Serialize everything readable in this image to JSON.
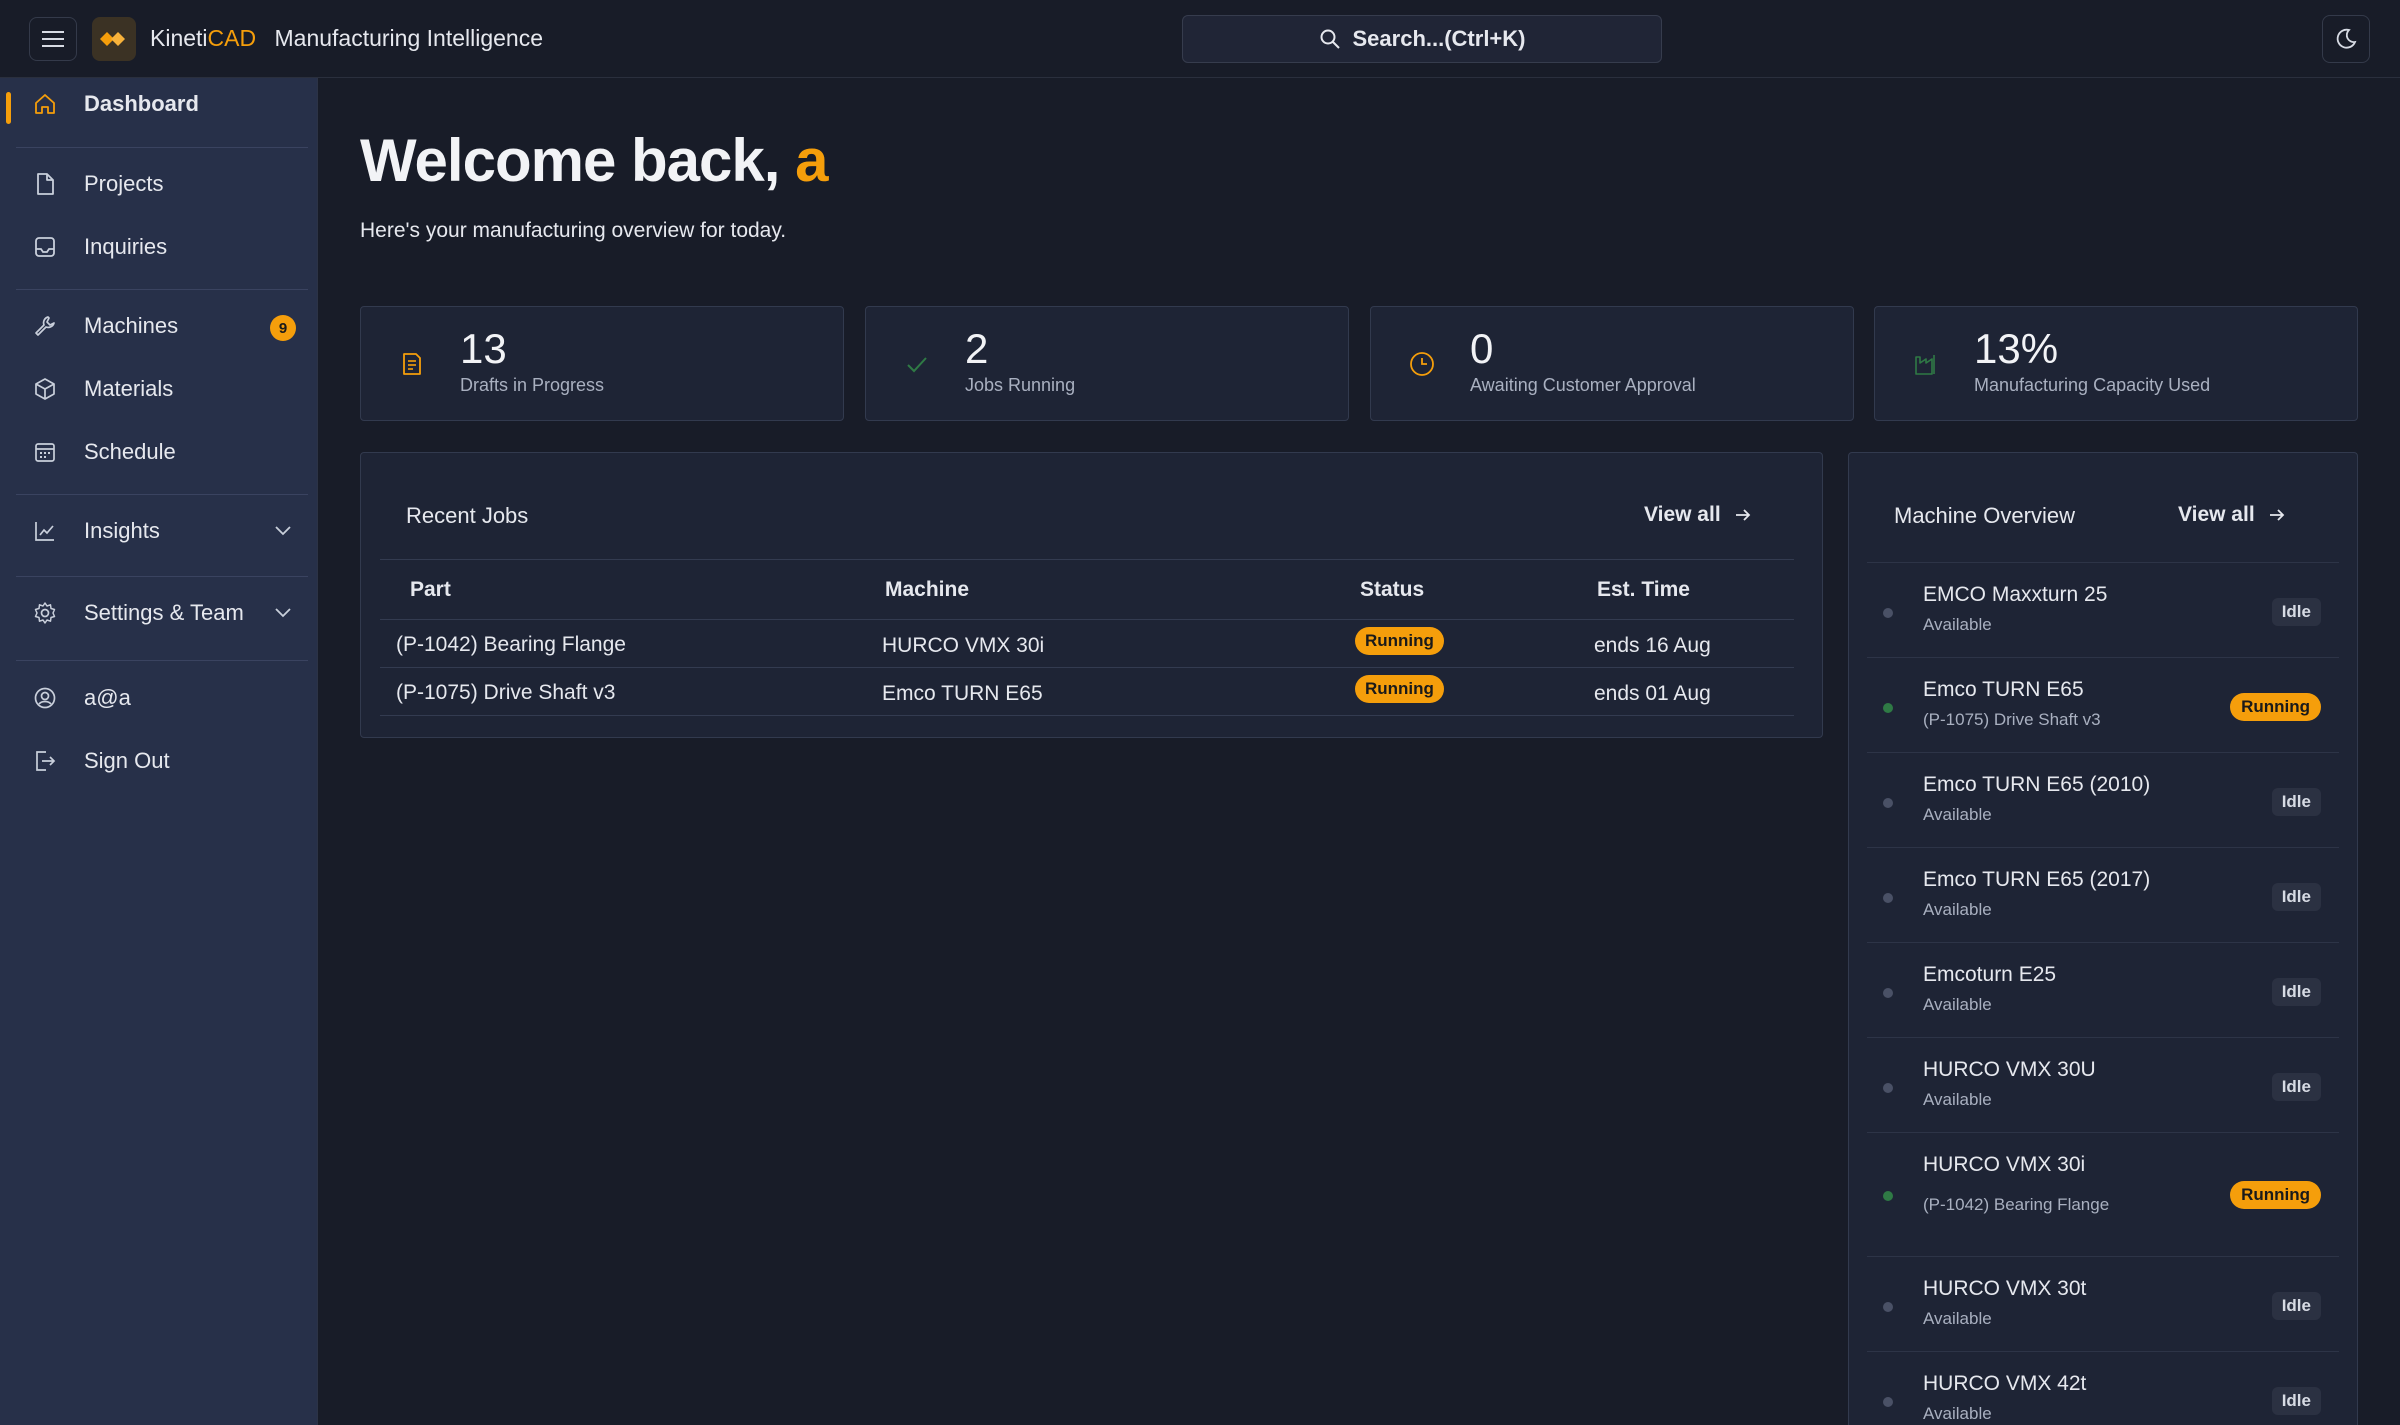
{
  "header": {
    "brand_prefix": "Kineti",
    "brand_accent": "CAD",
    "brand_subtitle": "Manufacturing Intelligence",
    "search_label": "Search...(Ctrl+K)"
  },
  "sidebar": {
    "items": [
      {
        "label": "Dashboard",
        "icon": "home-icon",
        "active": true
      },
      {
        "label": "Projects",
        "icon": "file-icon"
      },
      {
        "label": "Inquiries",
        "icon": "inbox-icon"
      },
      {
        "label": "Machines",
        "icon": "wrench-icon",
        "badge": "9"
      },
      {
        "label": "Materials",
        "icon": "box-icon"
      },
      {
        "label": "Schedule",
        "icon": "calendar-icon"
      },
      {
        "label": "Insights",
        "icon": "chart-line-icon",
        "expandable": true
      },
      {
        "label": "Settings & Team",
        "icon": "gear-icon",
        "expandable": true
      },
      {
        "label": "a@a",
        "icon": "user-circle-icon"
      },
      {
        "label": "Sign Out",
        "icon": "sign-out-icon"
      }
    ]
  },
  "welcome": {
    "greeting": "Welcome back, ",
    "name": "a",
    "subtitle": "Here's your manufacturing overview for today."
  },
  "stats": [
    {
      "value": "13",
      "label": "Drafts in Progress",
      "icon": "document-icon",
      "color": "#f59e0b"
    },
    {
      "value": "2",
      "label": "Jobs Running",
      "icon": "check-icon",
      "color": "#2f7a45"
    },
    {
      "value": "0",
      "label": "Awaiting Customer Approval",
      "icon": "clock-icon",
      "color": "#f59e0b"
    },
    {
      "value": "13%",
      "label": "Manufacturing Capacity Used",
      "icon": "factory-icon",
      "color": "#2f7a45"
    }
  ],
  "recent_jobs": {
    "title": "Recent Jobs",
    "view_all": "View all",
    "columns": [
      "Part",
      "Machine",
      "Status",
      "Est. Time"
    ],
    "rows": [
      {
        "part": "(P-1042) Bearing Flange",
        "machine": "HURCO VMX 30i",
        "status": "Running",
        "est": "ends 16 Aug"
      },
      {
        "part": "(P-1075) Drive Shaft v3",
        "machine": "Emco TURN E65",
        "status": "Running",
        "est": "ends 01 Aug"
      }
    ]
  },
  "machine_overview": {
    "title": "Machine Overview",
    "view_all": "View all",
    "machines": [
      {
        "name": "EMCO Maxxturn 25",
        "sub": "Available",
        "status": "Idle"
      },
      {
        "name": "Emco TURN E65",
        "sub": "(P-1075) Drive Shaft v3",
        "status": "Running"
      },
      {
        "name": "Emco TURN E65 (2010)",
        "sub": "Available",
        "status": "Idle"
      },
      {
        "name": "Emco TURN E65 (2017)",
        "sub": "Available",
        "status": "Idle"
      },
      {
        "name": "Emcoturn E25",
        "sub": "Available",
        "status": "Idle"
      },
      {
        "name": "HURCO VMX 30U",
        "sub": "Available",
        "status": "Idle"
      },
      {
        "name": "HURCO VMX 30i",
        "sub": "(P-1042) Bearing Flange",
        "status": "Running"
      },
      {
        "name": "HURCO VMX 30t",
        "sub": "Available",
        "status": "Idle"
      },
      {
        "name": "HURCO VMX 42t",
        "sub": "Available",
        "status": "Idle"
      }
    ]
  },
  "colors": {
    "accent": "#f59e0b",
    "background": "#181c28",
    "sidebar": "#273049",
    "card": "#1e2435",
    "running_dot": "#2f7a45"
  }
}
